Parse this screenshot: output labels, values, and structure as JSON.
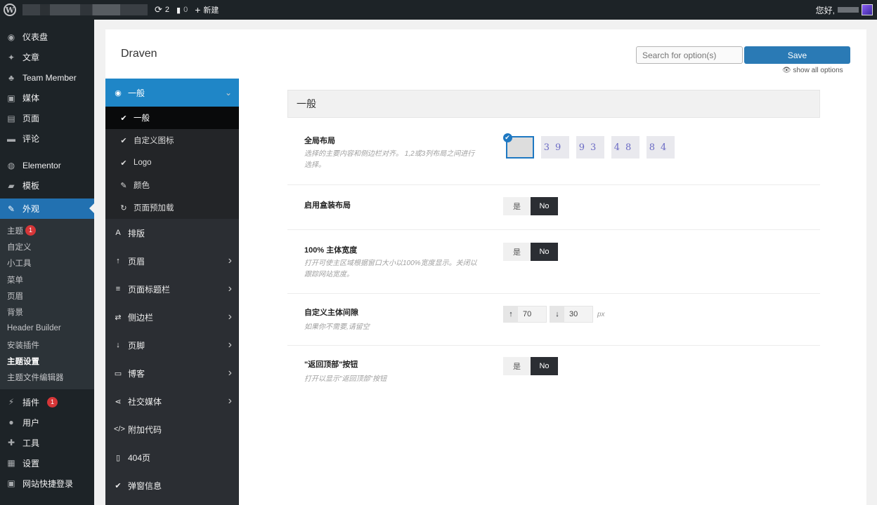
{
  "adminbar": {
    "updates_count": "2",
    "comments_count": "0",
    "new_label": "新建",
    "greeting": "您好,"
  },
  "wp_menu": {
    "items_top": [
      {
        "label": "仪表盘",
        "icon": "dashboard-icon"
      },
      {
        "label": "文章",
        "icon": "pin-icon"
      },
      {
        "label": "Team Member",
        "icon": "group-icon"
      },
      {
        "label": "媒体",
        "icon": "media-icon"
      },
      {
        "label": "页面",
        "icon": "page-icon"
      },
      {
        "label": "评论",
        "icon": "comment-icon"
      },
      {
        "label": "Elementor",
        "icon": "elementor-icon"
      },
      {
        "label": "模板",
        "icon": "folder-icon"
      }
    ],
    "current": {
      "label": "外观",
      "icon": "brush-icon"
    },
    "sub_items": [
      {
        "label": "主题",
        "badge": "1"
      },
      {
        "label": "自定义"
      },
      {
        "label": "小工具"
      },
      {
        "label": "菜单"
      },
      {
        "label": "页眉"
      },
      {
        "label": "背景"
      },
      {
        "label": "Header Builder"
      },
      {
        "label": "安装插件"
      },
      {
        "label": "主题设置",
        "strong": true
      },
      {
        "label": "主题文件编辑器"
      }
    ],
    "items_bottom": [
      {
        "label": "插件",
        "badge": "1",
        "icon": "plugin-icon"
      },
      {
        "label": "用户",
        "icon": "user-icon"
      },
      {
        "label": "工具",
        "icon": "wrench-icon"
      },
      {
        "label": "设置",
        "icon": "settings-icon"
      },
      {
        "label": "网站快捷登录",
        "icon": "login-icon"
      }
    ]
  },
  "panel": {
    "brand": "Draven",
    "search_placeholder": "Search for option(s)",
    "save_label": "Save",
    "show_all": "show all options"
  },
  "option_nav": {
    "active": {
      "label": "一般"
    },
    "sub_items": [
      {
        "label": "一般",
        "active": true,
        "icon": "check-icon"
      },
      {
        "label": "自定义图标",
        "icon": "check-icon"
      },
      {
        "label": "Logo",
        "icon": "check-icon"
      },
      {
        "label": "颜色",
        "icon": "brush-icon"
      },
      {
        "label": "页面预加载",
        "icon": "refresh-icon"
      }
    ],
    "items": [
      {
        "label": "排版",
        "icon": "font-icon",
        "chevron": false
      },
      {
        "label": "页眉",
        "icon": "arrow-up-icon",
        "chevron": true
      },
      {
        "label": "页面标题栏",
        "icon": "sliders-icon",
        "chevron": true
      },
      {
        "label": "侧边栏",
        "icon": "exchange-icon",
        "chevron": true
      },
      {
        "label": "页脚",
        "icon": "arrow-down-icon",
        "chevron": true
      },
      {
        "label": "博客",
        "icon": "newspaper-icon",
        "chevron": true
      },
      {
        "label": "社交媒体",
        "icon": "share-icon",
        "chevron": true
      },
      {
        "label": "附加代码",
        "icon": "code-icon",
        "chevron": false
      },
      {
        "label": "404页",
        "icon": "file-icon",
        "chevron": false
      },
      {
        "label": "弹窗信息",
        "icon": "check-icon",
        "chevron": false
      }
    ]
  },
  "content": {
    "section_title": "一般",
    "layout": {
      "title": "全局布局",
      "desc": "选择的主要内容和侧边栏对齐。 1,2或3列布局之间进行选择。",
      "options": [
        {
          "text": "",
          "selected": true
        },
        {
          "text": "39",
          "selected": false
        },
        {
          "text": "93",
          "selected": false
        },
        {
          "text": "48",
          "selected": false
        },
        {
          "text": "84",
          "selected": false
        }
      ]
    },
    "boxed": {
      "title": "启用盒装布局",
      "yes": "是",
      "no": "No"
    },
    "fullwidth": {
      "title": "100% 主体宽度",
      "desc": "打开可使主区域根据窗口大小以100%宽度显示。关闭以跟踪网站宽度。",
      "yes": "是",
      "no": "No"
    },
    "spacing": {
      "title": "自定义主体间隙",
      "desc": "如果你不需要,请留空",
      "top_value": "70",
      "bottom_value": "30",
      "unit": "px"
    },
    "backtotop": {
      "title": "\"返回顶部\"按钮",
      "desc": "打开以显示\"返回顶部\"按钮",
      "yes": "是",
      "no": "No"
    }
  }
}
